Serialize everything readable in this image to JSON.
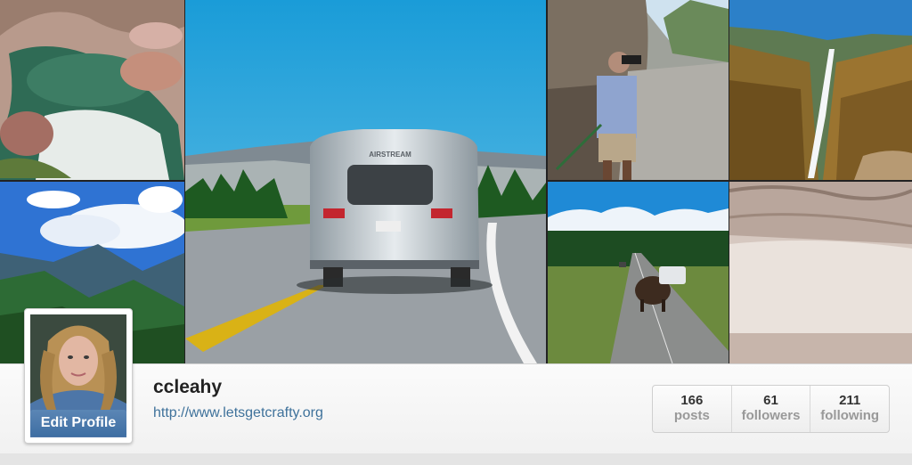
{
  "profile": {
    "username": "ccleahy",
    "website": "http://www.letsgetcrafty.org",
    "edit_profile_label": "Edit Profile",
    "license_plate": "",
    "trailer_brand": "AIRSTREAM"
  },
  "stats": [
    {
      "count": "166",
      "label": "posts"
    },
    {
      "count": "61",
      "label": "followers"
    },
    {
      "count": "211",
      "label": "following"
    }
  ],
  "photos": [
    {
      "subject": "river-rocks-photo"
    },
    {
      "subject": "mountain-valley-photo"
    },
    {
      "subject": "airstream-road-photo"
    },
    {
      "subject": "hiker-binoculars-photo"
    },
    {
      "subject": "bison-road-photo"
    },
    {
      "subject": "canyon-waterfall-photo"
    },
    {
      "subject": "hot-springs-terrace-photo"
    }
  ],
  "colors": {
    "link": "#3f729b",
    "edit_button": "#3e6ea3",
    "username": "#222222",
    "stat_label": "#999999"
  }
}
